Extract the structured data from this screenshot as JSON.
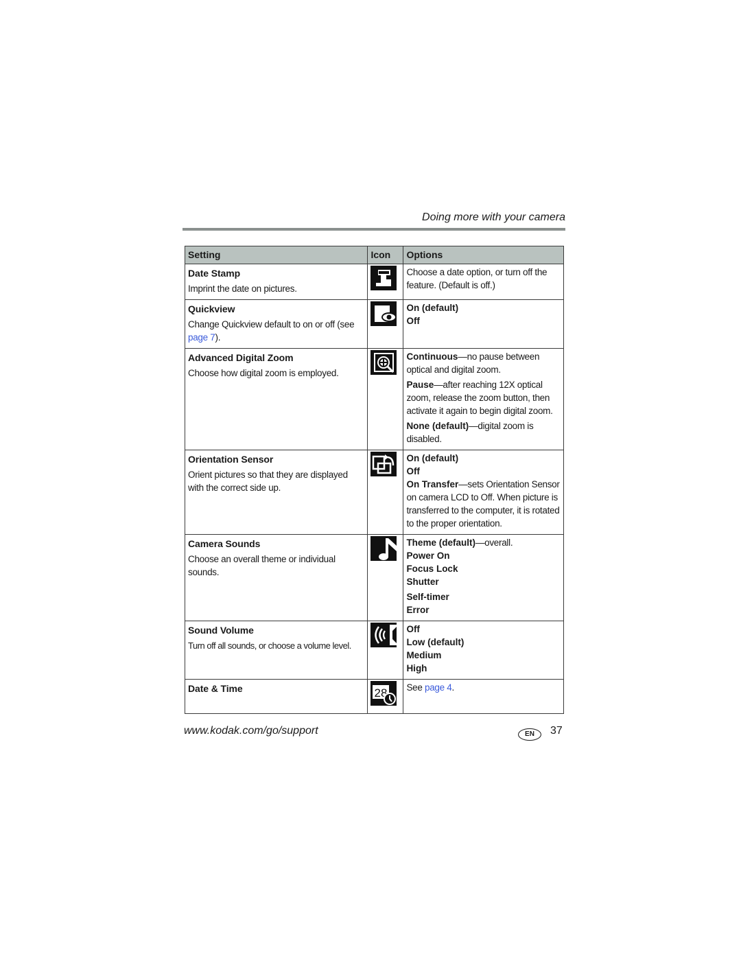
{
  "header": {
    "running_head": "Doing more with your camera"
  },
  "table": {
    "columns": [
      "Setting",
      "Icon",
      "Options"
    ],
    "rows": [
      {
        "name": "Date Stamp",
        "desc": "Imprint the date on pictures.",
        "icon": "date-stamp-icon",
        "options": [
          {
            "text": "Choose a date option, or turn off the feature. (Default is off.)"
          }
        ]
      },
      {
        "name": "Quickview",
        "desc_before": "Change Quickview default to on or off (see ",
        "desc_link": "page 7",
        "desc_after": ").",
        "icon": "quickview-eye-icon",
        "options": [
          {
            "bold": "On (default)"
          },
          {
            "bold": "Off"
          }
        ]
      },
      {
        "name": "Advanced Digital Zoom",
        "desc": "Choose how digital zoom is employed.",
        "icon": "digital-zoom-magnifier-icon",
        "options": [
          {
            "bold": "Continuous",
            "text": "—no pause between optical and digital zoom."
          },
          {
            "bold": "Pause",
            "text": "—after reaching 12X optical zoom, release the zoom button, then activate it again to begin digital zoom."
          },
          {
            "bold": "None (default)",
            "text": "—digital zoom is disabled."
          }
        ]
      },
      {
        "name": "Orientation Sensor",
        "desc": "Orient pictures so that they are displayed with the correct side up.",
        "icon": "orientation-rotate-icon",
        "options": [
          {
            "bold": "On (default)"
          },
          {
            "bold": "Off"
          },
          {
            "bold": "On Transfer",
            "text": "—sets Orientation Sensor on camera LCD to Off. When picture is transferred to the computer, it is rotated to the proper orientation."
          }
        ]
      },
      {
        "name": "Camera Sounds",
        "desc": "Choose an overall theme or individual sounds.",
        "icon": "music-note-icon",
        "options": [
          {
            "bold": "Theme (default)",
            "text": "—overall."
          },
          {
            "bold": "Power On"
          },
          {
            "bold": "Focus Lock"
          },
          {
            "bold": "Shutter"
          },
          {
            "bold": "Self-timer"
          },
          {
            "bold": "Error"
          }
        ]
      },
      {
        "name": "Sound Volume",
        "desc": "Turn off all sounds, or choose a volume level.",
        "icon": "speaker-volume-icon",
        "options": [
          {
            "bold": "Off"
          },
          {
            "bold": "Low (default)"
          },
          {
            "bold": "Medium"
          },
          {
            "bold": "High"
          }
        ]
      },
      {
        "name": "Date & Time",
        "icon": "calendar-clock-icon",
        "icon_text": "28",
        "options_before": "See ",
        "options_link": "page 4",
        "options_after": "."
      }
    ]
  },
  "footer": {
    "url": "www.kodak.com/go/support",
    "lang": "EN",
    "page": "37"
  },
  "colors": {
    "header_bg": "#b9c2bf",
    "rule": "#8a908e",
    "link": "#3b5bdb"
  }
}
